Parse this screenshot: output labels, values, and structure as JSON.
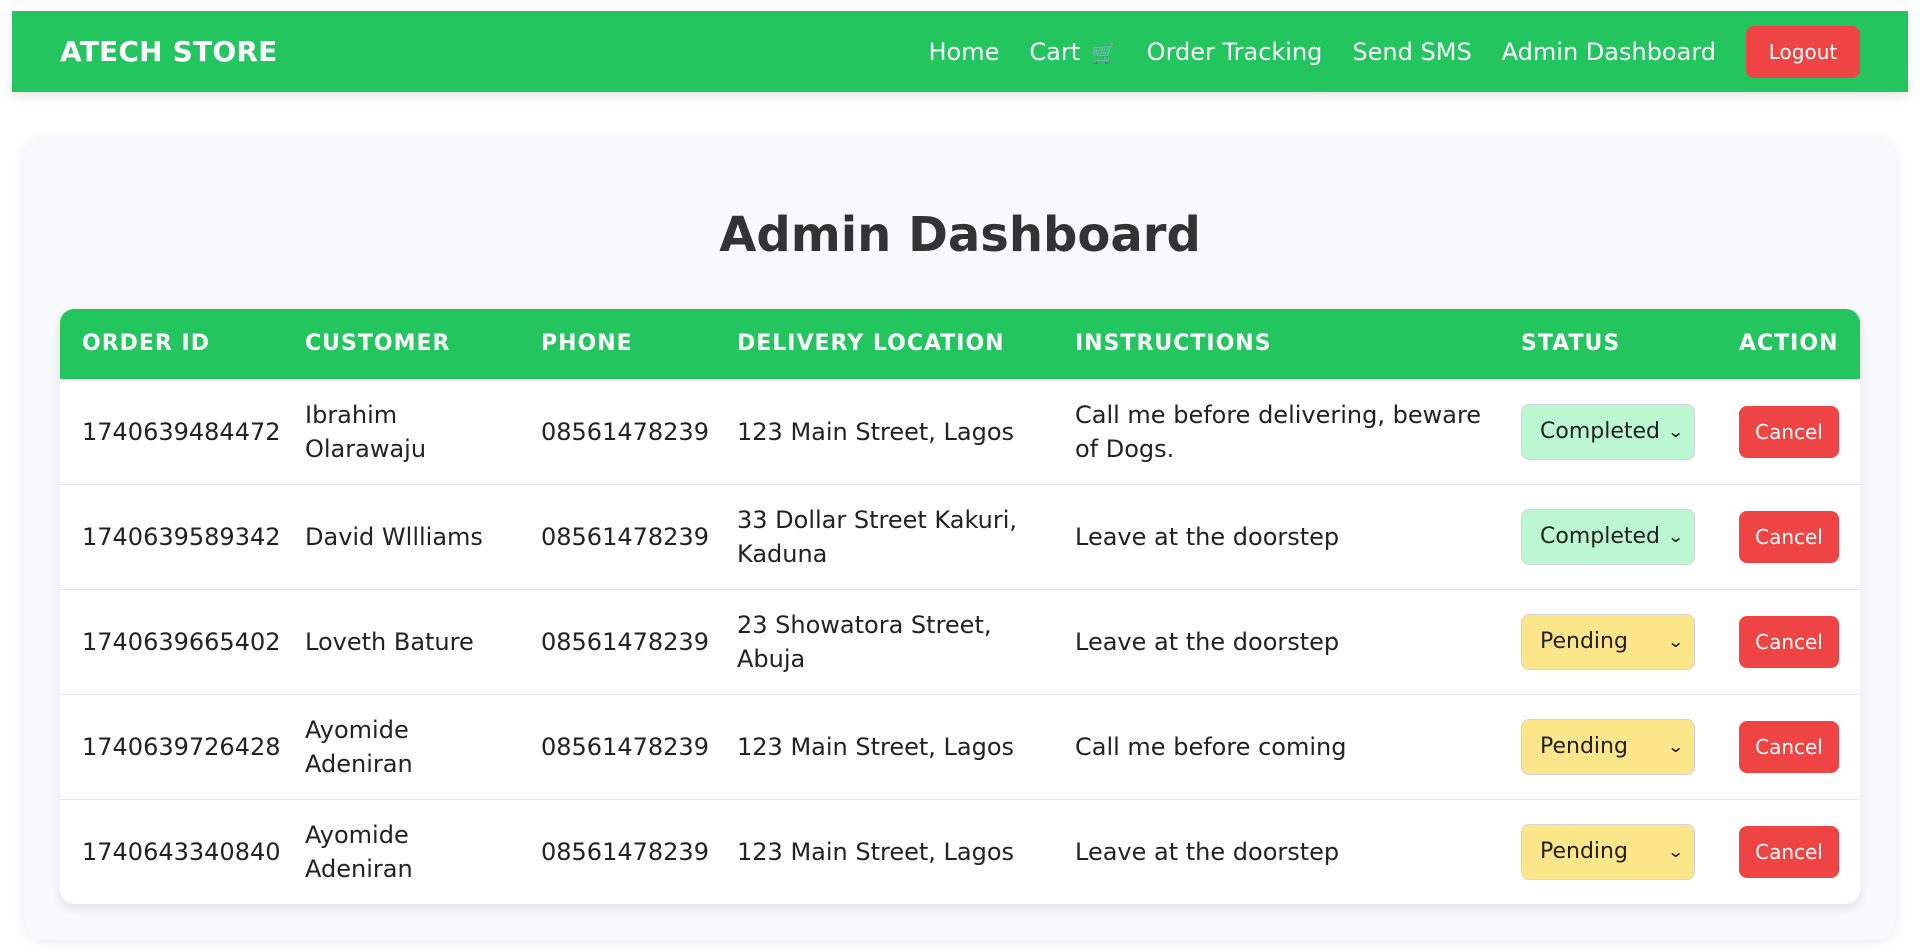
{
  "navbar": {
    "brand": "ATECH STORE",
    "links": {
      "home": "Home",
      "cart": "Cart",
      "cart_icon": "🛒",
      "order_tracking": "Order Tracking",
      "send_sms": "Send SMS",
      "admin_dashboard": "Admin Dashboard"
    },
    "logout_label": "Logout"
  },
  "main": {
    "title": "Admin Dashboard",
    "table": {
      "headers": [
        "ORDER ID",
        "CUSTOMER",
        "PHONE",
        "DELIVERY LOCATION",
        "INSTRUCTIONS",
        "STATUS",
        "ACTION"
      ],
      "rows": [
        {
          "order_id": "1740639484472",
          "customer": "Ibrahim Olarawaju",
          "phone": "08561478239",
          "location": "123 Main Street, Lagos",
          "instructions": "Call me before delivering, beware of Dogs.",
          "status": "Completed",
          "action": "Cancel"
        },
        {
          "order_id": "1740639589342",
          "customer": "David Wllliams",
          "phone": "08561478239",
          "location": "33 Dollar Street Kakuri, Kaduna",
          "instructions": "Leave at the doorstep",
          "status": "Completed",
          "action": "Cancel"
        },
        {
          "order_id": "1740639665402",
          "customer": "Loveth Bature",
          "phone": "08561478239",
          "location": "23 Showatora Street, Abuja",
          "instructions": "Leave at the doorstep",
          "status": "Pending",
          "action": "Cancel"
        },
        {
          "order_id": "1740639726428",
          "customer": "Ayomide Adeniran",
          "phone": "08561478239",
          "location": "123 Main Street, Lagos",
          "instructions": "Call me before coming",
          "status": "Pending",
          "action": "Cancel"
        },
        {
          "order_id": "1740643340840",
          "customer": "Ayomide Adeniran",
          "phone": "08561478239",
          "location": "123 Main Street, Lagos",
          "instructions": "Leave at the doorstep",
          "status": "Pending",
          "action": "Cancel"
        }
      ]
    }
  },
  "colors": {
    "brand_green": "#22c55e",
    "danger_red": "#ef4444",
    "completed_bg": "#bbf7d0",
    "pending_bg": "#fde68a"
  },
  "icons": {
    "cart": "cart-icon",
    "dropdown": "chevron-down-icon"
  }
}
